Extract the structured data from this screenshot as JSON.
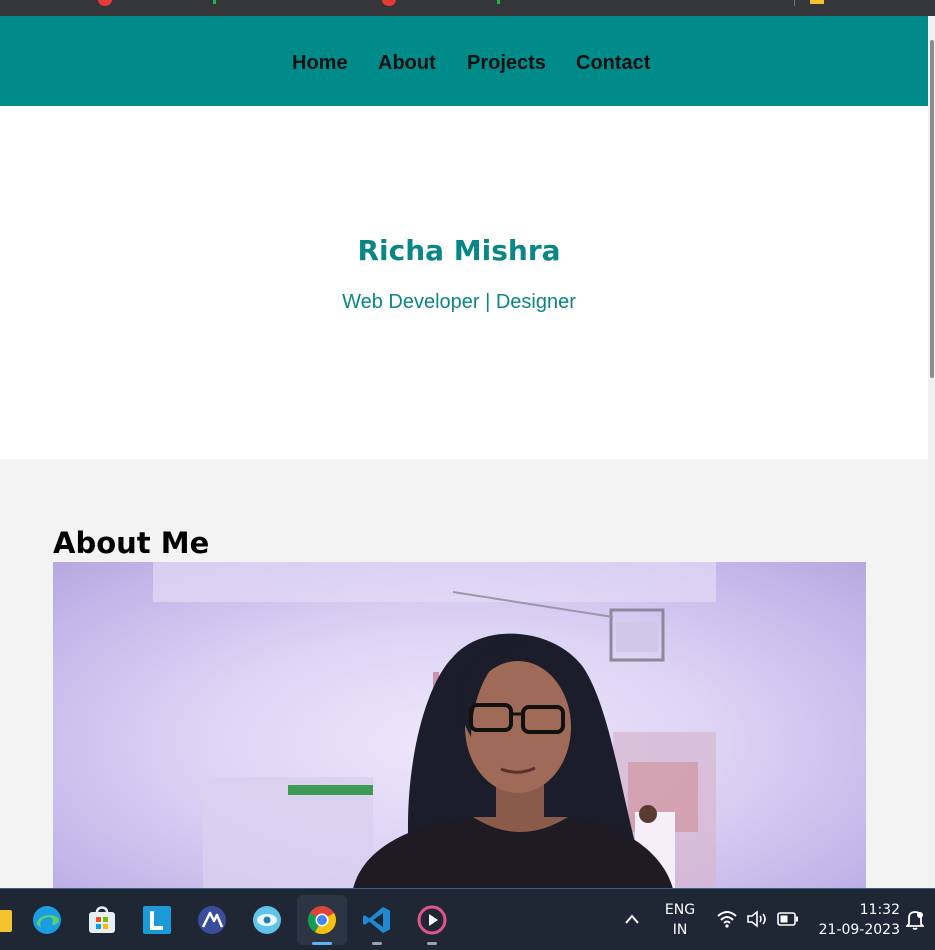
{
  "nav": {
    "links": [
      "Home",
      "About",
      "Projects",
      "Contact"
    ]
  },
  "hero": {
    "name": "Richa Mishra",
    "role": "Web Developer | Designer"
  },
  "about": {
    "heading": "About Me",
    "photo": "profile-photo"
  },
  "taskbar": {
    "language": {
      "line1": "ENG",
      "line2": "IN"
    },
    "clock": {
      "time": "11:32",
      "date": "21-09-2023"
    },
    "apps": [
      "file-explorer",
      "edge",
      "microsoft-store",
      "l-app",
      "ai-app",
      "eye-app",
      "chrome",
      "vs-code",
      "media-player"
    ]
  },
  "colors": {
    "accent": "#008b8b",
    "accent_text": "#0b8686",
    "about_bg": "#f3f3f3",
    "taskbar_bg": "#1f2734"
  }
}
